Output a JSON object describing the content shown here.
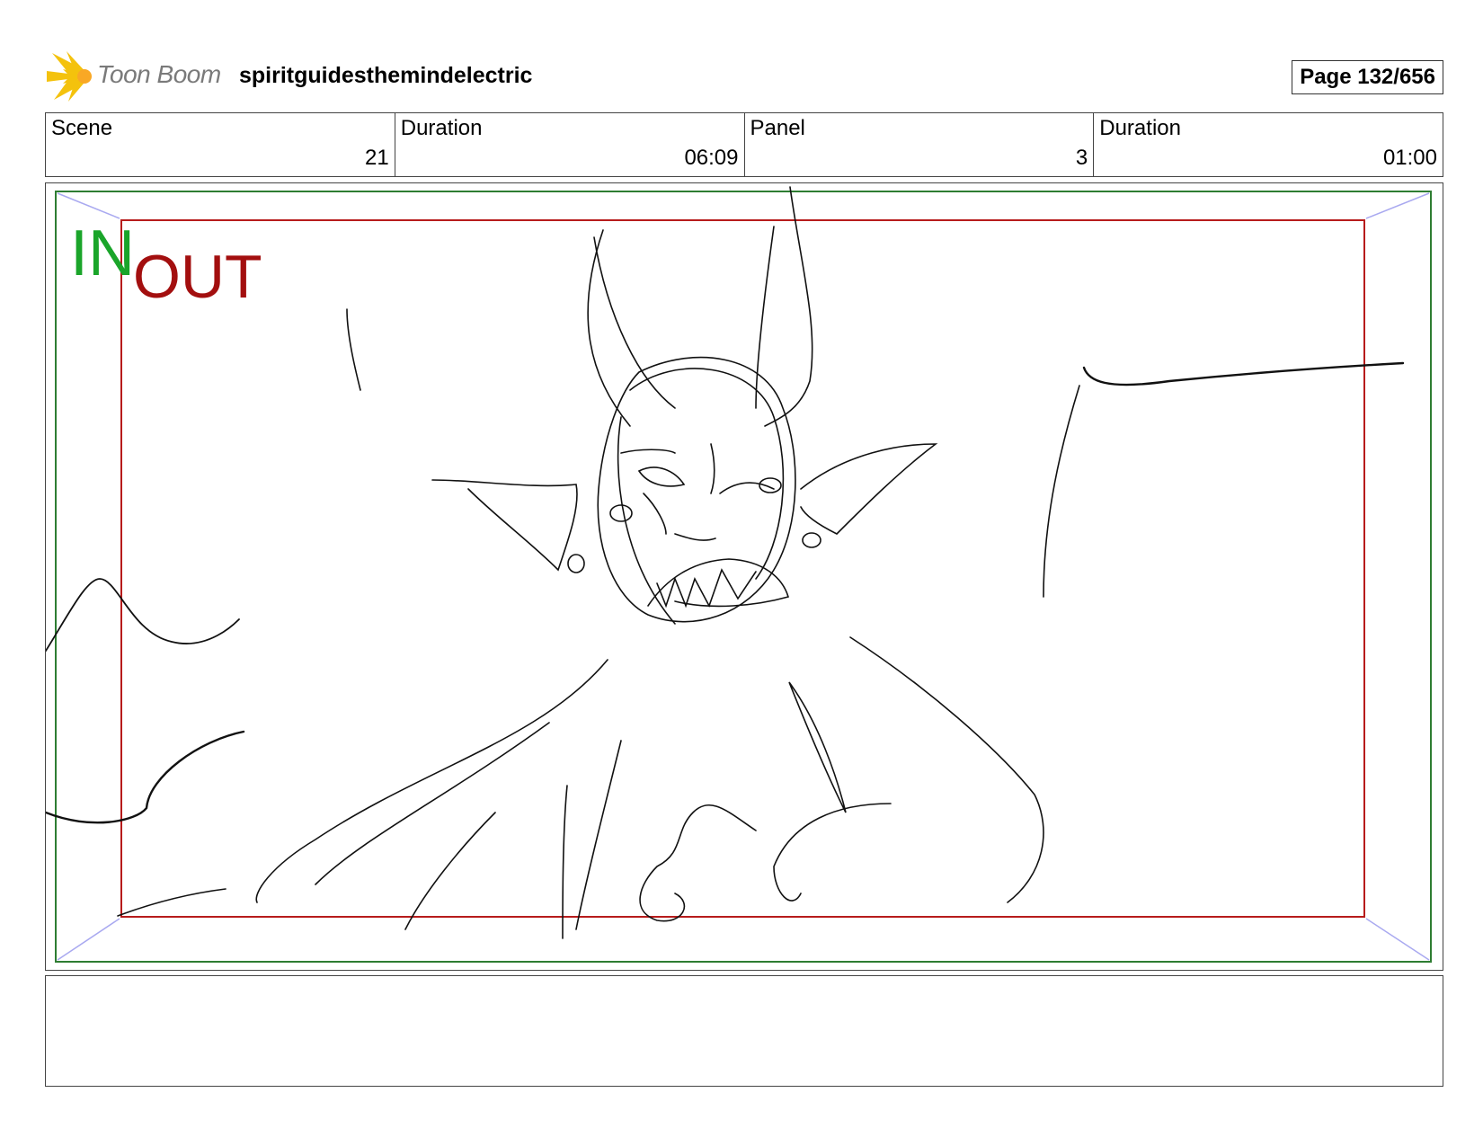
{
  "header": {
    "logo_text": "Toon Boom",
    "project_title": "spiritguidesthemindelectric",
    "page_label": "Page 132/656"
  },
  "info": [
    {
      "label": "Scene",
      "value": "21"
    },
    {
      "label": "Duration",
      "value": "06:09"
    },
    {
      "label": "Panel",
      "value": "3"
    },
    {
      "label": "Duration",
      "value": "01:00"
    }
  ],
  "panel": {
    "in_label": "IN",
    "out_label": "OUT",
    "colors": {
      "safe_frame": "#2e7d32",
      "camera_frame": "#b71c1c",
      "in": "#1aa52a",
      "out": "#a30f0f",
      "corner_arrow": "#a9a9f0"
    }
  },
  "notes": {
    "text": ""
  }
}
